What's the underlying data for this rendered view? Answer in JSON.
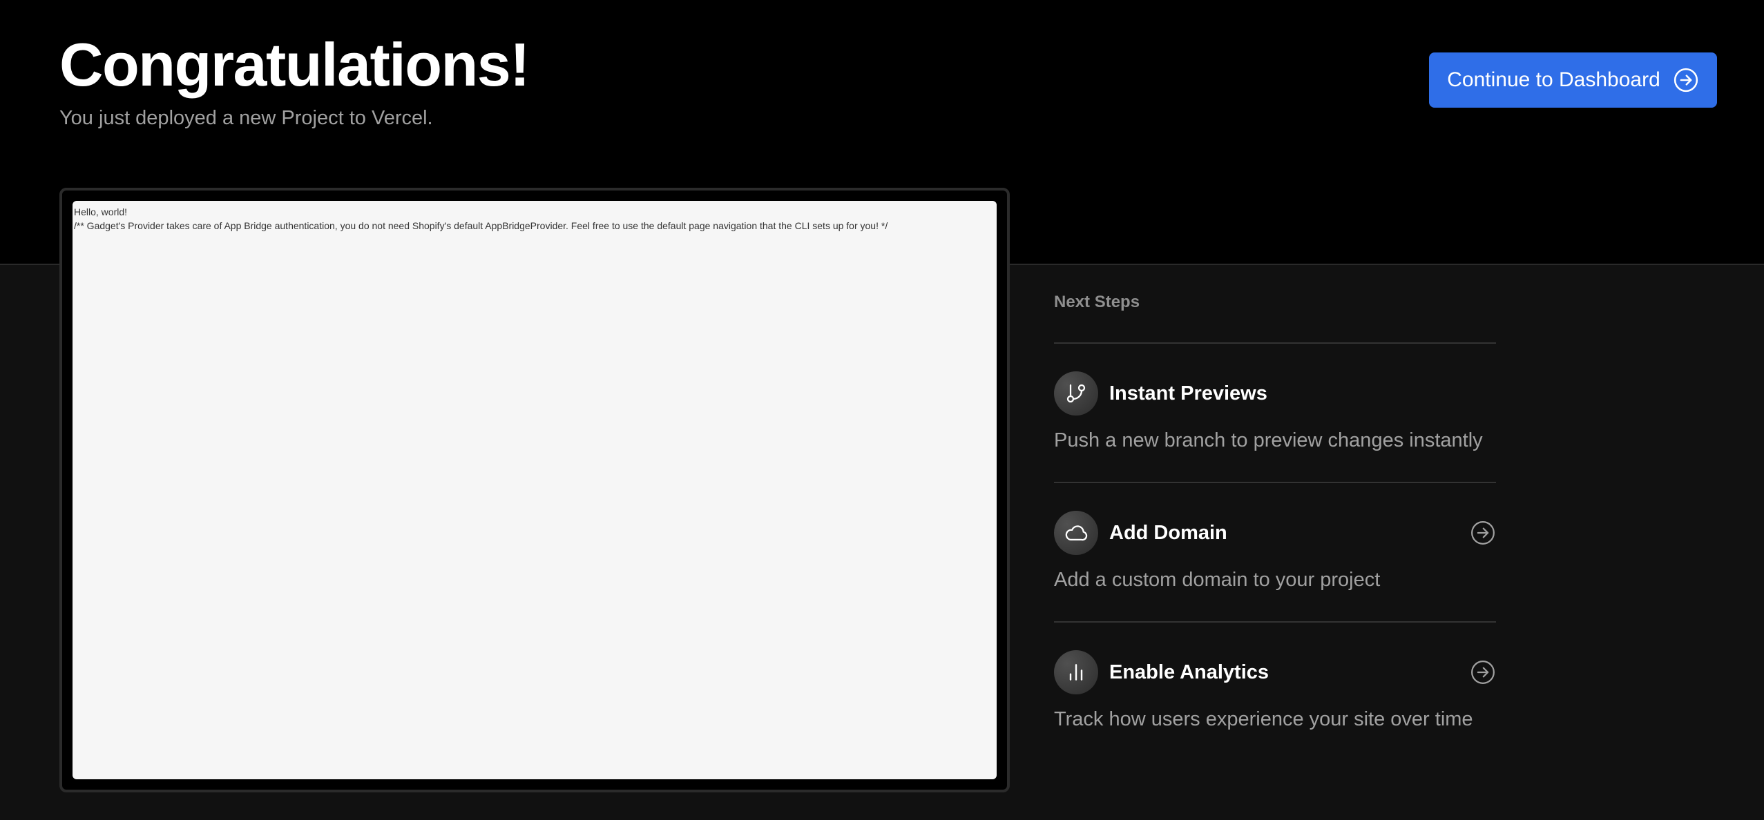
{
  "header": {
    "title": "Congratulations!",
    "subtitle": "You just deployed a new Project to Vercel.",
    "continue_label": "Continue to Dashboard",
    "continue_icon": "arrow-right-circle-icon"
  },
  "preview": {
    "lines": [
      "Hello, world!",
      "/** Gadget's Provider takes care of App Bridge authentication, you do not need Shopify's default AppBridgeProvider. Feel free to use the default page navigation that the CLI sets up for you! */"
    ]
  },
  "next_steps": {
    "heading": "Next Steps",
    "items": [
      {
        "title": "Instant Previews",
        "description": "Push a new branch to preview changes instantly",
        "icon": "git-branch-icon",
        "has_arrow": false
      },
      {
        "title": "Add Domain",
        "description": "Add a custom domain to your project",
        "icon": "cloud-icon",
        "has_arrow": true
      },
      {
        "title": "Enable Analytics",
        "description": "Track how users experience your site over time",
        "icon": "bar-chart-icon",
        "has_arrow": true
      }
    ]
  },
  "colors": {
    "accent": "#2f6ee8",
    "top_background": "#000000",
    "page_background": "#111111",
    "muted_text": "#a1a1a1"
  }
}
